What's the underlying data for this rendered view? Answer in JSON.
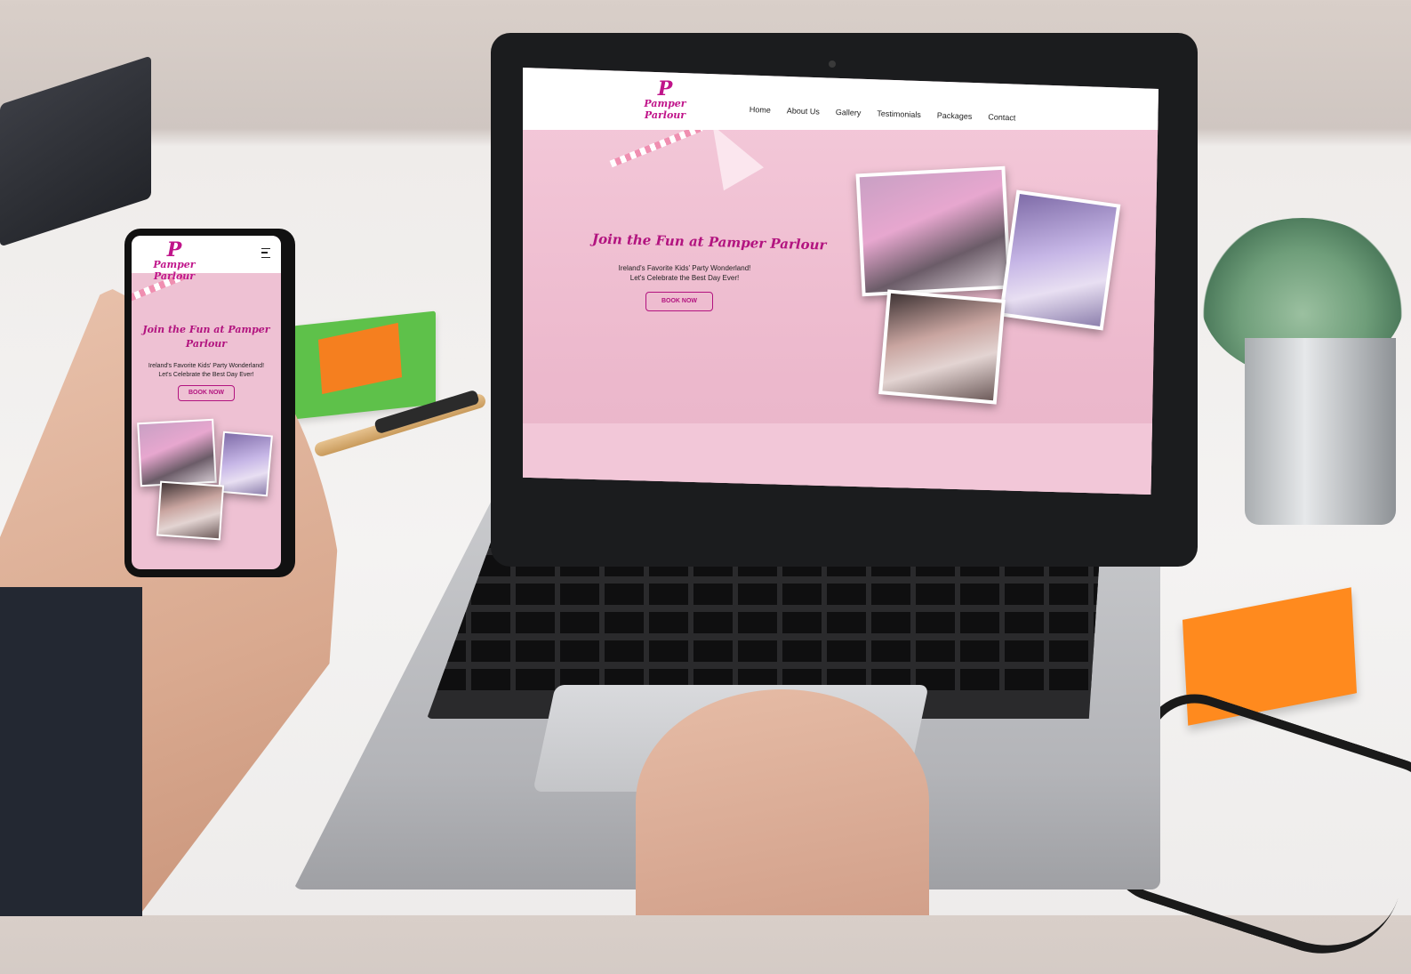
{
  "desktop_site": {
    "logo": {
      "mark": "P",
      "text": "Pamper Parlour"
    },
    "nav": [
      "Home",
      "About Us",
      "Gallery",
      "Testimonials",
      "Packages",
      "Contact"
    ],
    "hero": {
      "title": "Join the Fun at Pamper Parlour",
      "subtitle_line1": "Ireland's Favorite Kids' Party Wonderland!",
      "subtitle_line2": "Let's Celebrate the Best Day Ever!",
      "cta": "BOOK NOW"
    }
  },
  "mobile_site": {
    "logo": {
      "mark": "P",
      "text": "Pamper Parlour"
    },
    "hero": {
      "title": "Join the Fun at Pamper Parlour",
      "subtitle_line1": "Ireland's Favorite Kids' Party Wonderland!",
      "subtitle_line2": "Let's Celebrate the Best Day Ever!",
      "cta": "BOOK NOW"
    }
  },
  "colors": {
    "brand_magenta": "#b2137f",
    "hero_pink": "#eec1d3",
    "header_white": "#ffffff"
  }
}
